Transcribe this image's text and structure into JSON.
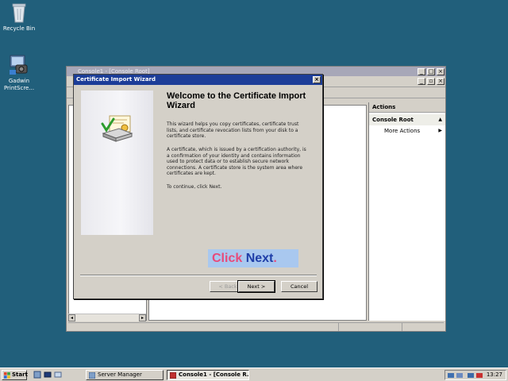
{
  "desktop": {
    "icons": [
      {
        "label": "Recycle Bin",
        "icon": "recycle-bin-icon"
      },
      {
        "label": "Gadwin PrintScre...",
        "icon": "gadwin-printscreen-icon"
      }
    ]
  },
  "console": {
    "title": "Console1 - [Console Root]",
    "actions": {
      "header": "Actions",
      "group": "Console Root",
      "item": "More Actions"
    }
  },
  "wizard": {
    "title": "Certificate Import Wizard",
    "heading": "Welcome to the Certificate Import Wizard",
    "paragraph1": "This wizard helps you copy certificates, certificate trust lists, and certificate revocation lists from your disk to a certificate store.",
    "paragraph2": "A certificate, which is issued by a certification authority, is a confirmation of your identity and contains information used to protect data or to establish secure network connections. A certificate store is the system area where certificates are kept.",
    "paragraph3": "To continue, click Next.",
    "overlay": {
      "word1": "Click",
      "word2": "Next",
      "dot": "."
    },
    "buttons": {
      "back": "< Back",
      "next": "Next >",
      "cancel": "Cancel"
    }
  },
  "taskbar": {
    "start": "Start",
    "tasks": [
      {
        "label": "Server Manager",
        "active": false
      },
      {
        "label": "Console1 - [Console R...",
        "active": true
      }
    ],
    "clock": "13:27"
  },
  "colors": {
    "desktop": "#215f7b",
    "wizard_title": "#1c3d98",
    "overlay_bg": "#a9c8ef",
    "overlay_pink": "#e84a7a",
    "overlay_blue": "#1f3ea8"
  }
}
